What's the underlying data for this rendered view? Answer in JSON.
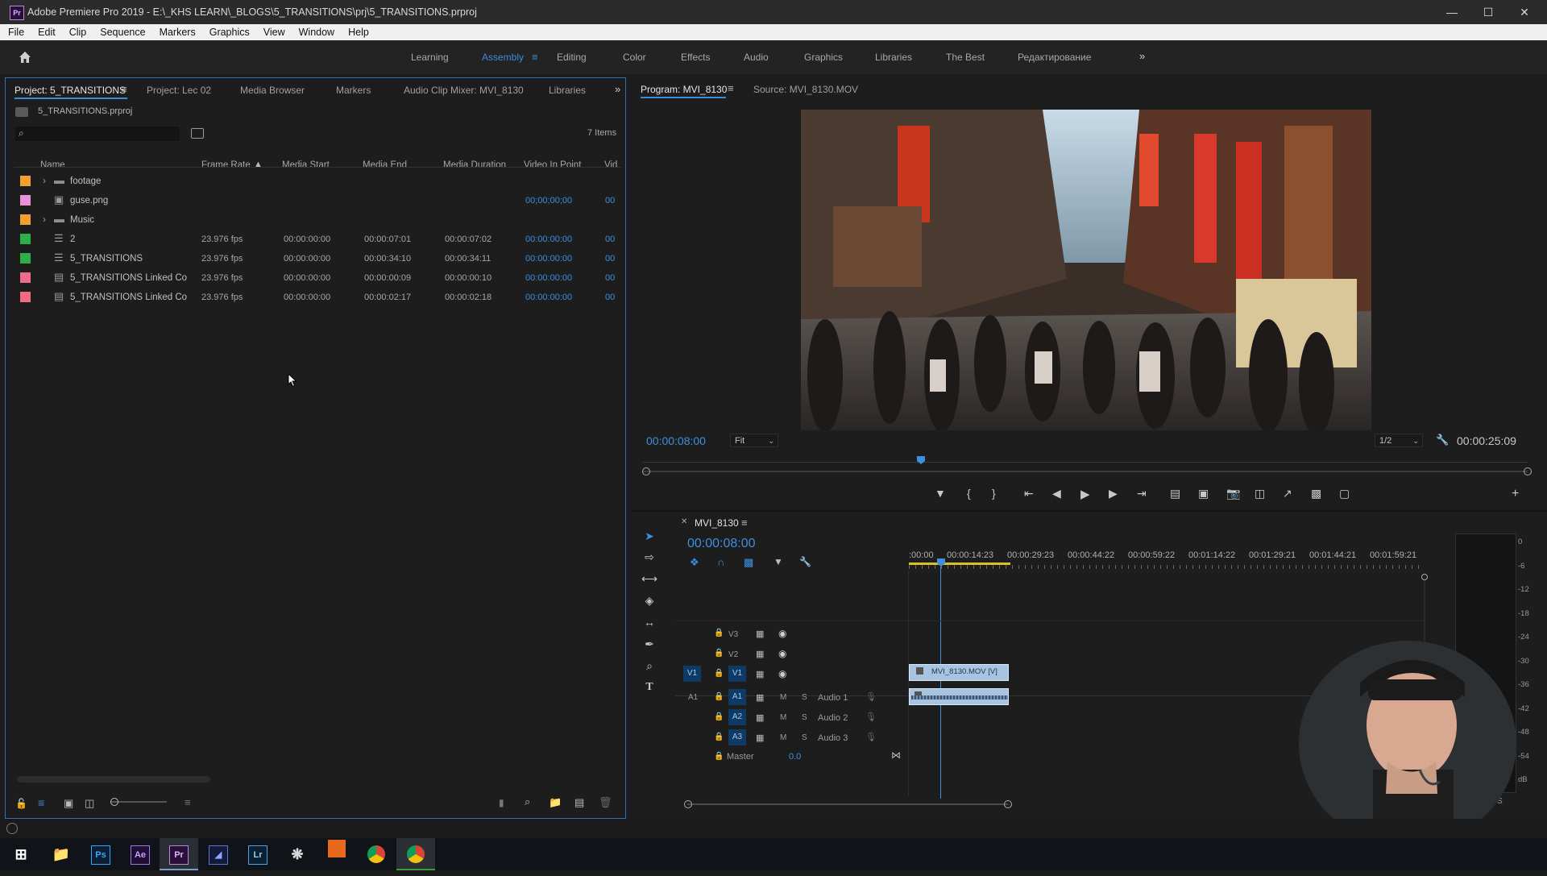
{
  "window": {
    "title": "Adobe Premiere Pro 2019 - E:\\_KHS LEARN\\_BLOGS\\5_TRANSITIONS\\prj\\5_TRANSITIONS.prproj",
    "app_icon": "Pr"
  },
  "menu": [
    "File",
    "Edit",
    "Clip",
    "Sequence",
    "Markers",
    "Graphics",
    "View",
    "Window",
    "Help"
  ],
  "workspaces": {
    "items": [
      "Learning",
      "Assembly",
      "Editing",
      "Color",
      "Effects",
      "Audio",
      "Graphics",
      "Libraries",
      "The Best",
      "Редактирование"
    ],
    "active": "Assembly"
  },
  "project_panel": {
    "tabs": [
      "Project: 5_TRANSITIONS",
      "Project: Lec 02",
      "Media Browser",
      "Markers",
      "Audio Clip Mixer: MVI_8130",
      "Libraries"
    ],
    "file_name": "5_TRANSITIONS.prproj",
    "item_count": "7 Items",
    "columns": [
      "Name",
      "Frame Rate",
      "Media Start",
      "Media End",
      "Media Duration",
      "Video In Point",
      "Vid"
    ],
    "rows": [
      {
        "color": "#f0a030",
        "kind": "folder",
        "expand": "›",
        "name": "footage",
        "fps": "",
        "start": "",
        "end": "",
        "duration": "",
        "in": "",
        "vid": ""
      },
      {
        "color": "#e890d8",
        "kind": "image",
        "expand": "",
        "name": "guse.png",
        "fps": "",
        "start": "",
        "end": "",
        "duration": "",
        "in": "00;00;00;00",
        "vid": "00"
      },
      {
        "color": "#f0a030",
        "kind": "folder",
        "expand": "›",
        "name": "Music",
        "fps": "",
        "start": "",
        "end": "",
        "duration": "",
        "in": "",
        "vid": ""
      },
      {
        "color": "#2db04a",
        "kind": "sequence",
        "expand": "",
        "name": "2",
        "fps": "23.976 fps",
        "start": "00:00:00:00",
        "end": "00:00:07:01",
        "duration": "00:00:07:02",
        "in": "00:00:00:00",
        "vid": "00"
      },
      {
        "color": "#2db04a",
        "kind": "sequence",
        "expand": "",
        "name": "5_TRANSITIONS",
        "fps": "23.976 fps",
        "start": "00:00:00:00",
        "end": "00:00:34:10",
        "duration": "00:00:34:11",
        "in": "00:00:00:00",
        "vid": "00"
      },
      {
        "color": "#f06a8a",
        "kind": "clip",
        "expand": "",
        "name": "5_TRANSITIONS Linked Co",
        "fps": "23.976 fps",
        "start": "00:00:00:00",
        "end": "00:00:00:09",
        "duration": "00:00:00:10",
        "in": "00:00:00:00",
        "vid": "00"
      },
      {
        "color": "#f06a8a",
        "kind": "clip",
        "expand": "",
        "name": "5_TRANSITIONS Linked Co",
        "fps": "23.976 fps",
        "start": "00:00:00:00",
        "end": "00:00:02:17",
        "duration": "00:00:02:18",
        "in": "00:00:00:00",
        "vid": "00"
      }
    ]
  },
  "program_monitor": {
    "tabs": [
      "Program: MVI_8130",
      "Source: MVI_8130.MOV"
    ],
    "timecode": "00:00:08:00",
    "fit": "Fit",
    "resolution": "1/2",
    "duration": "00:00:25:09"
  },
  "timeline": {
    "sequence_name": "MVI_8130",
    "timecode": "00:00:08:00",
    "ruler": [
      ":00:00",
      "00:00:14:23",
      "00:00:29:23",
      "00:00:44:22",
      "00:00:59:22",
      "00:01:14:22",
      "00:01:29:21",
      "00:01:44:21",
      "00:01:59:21"
    ],
    "video_tracks": [
      "V3",
      "V2",
      "V1"
    ],
    "source_video": "V1",
    "source_audio": "A1",
    "audio_tracks": [
      {
        "id": "A1",
        "name": "Audio 1"
      },
      {
        "id": "A2",
        "name": "Audio 2"
      },
      {
        "id": "A3",
        "name": "Audio 3"
      }
    ],
    "master_label": "Master",
    "master_value": "0.0",
    "clip_video": "MVI_8130.MOV [V]",
    "meter_scale": [
      "0",
      "-6",
      "-12",
      "-18",
      "-24",
      "-30",
      "-36",
      "-42",
      "-48",
      "-54",
      "dB"
    ],
    "meter_solo": "S"
  },
  "taskbar": [
    "Ps",
    "Ae",
    "Pr",
    "Md",
    "Lr",
    "Dv",
    "Ae2",
    "Ch",
    "Ch2"
  ]
}
